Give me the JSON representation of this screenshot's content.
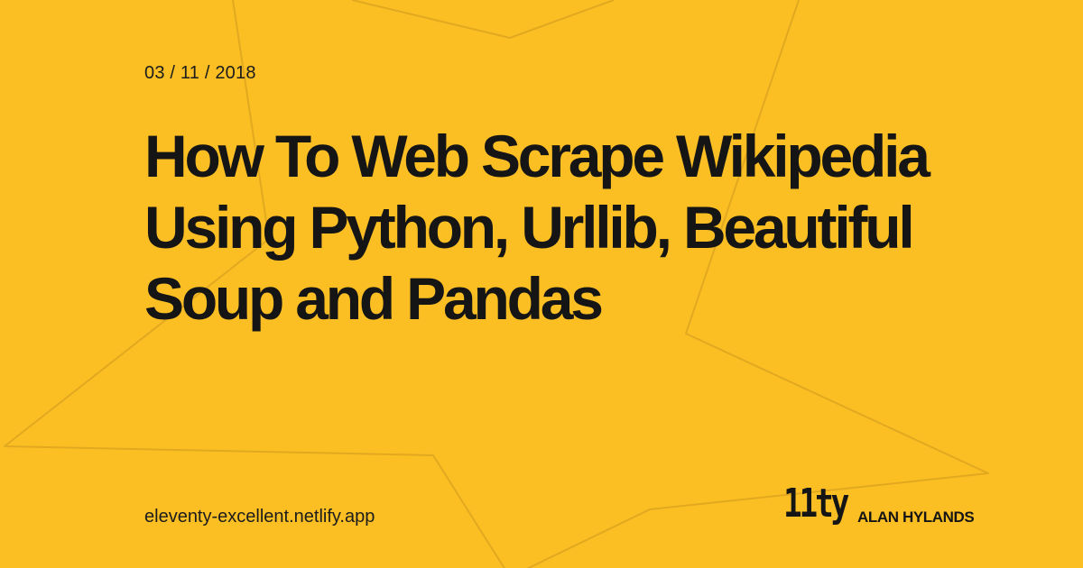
{
  "card": {
    "date": "03 / 11 / 2018",
    "title": "How To Web Scrape Wikipedia Using Python, Urllib, Beautiful Soup and Pandas",
    "site": "eleventy-excellent.netlify.app",
    "logo_text": "11ty",
    "author": "ALAN HYLANDS"
  },
  "colors": {
    "background": "#fbbf24",
    "text": "#171717",
    "star_outline": "#e0a81f"
  },
  "decoration": {
    "background_shape": "star-outline"
  }
}
